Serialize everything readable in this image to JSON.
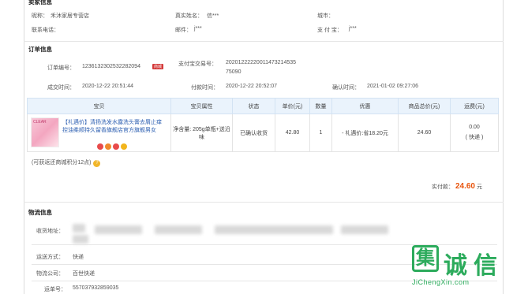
{
  "seller": {
    "section_title": "卖家信息",
    "nick_label": "昵称：",
    "nick_value": "禾沐家居专营店",
    "real_name_label": "真实姓名：",
    "real_name_value": "信***",
    "city_label": "城市：",
    "city_value": "",
    "phone_label": "联系电话：",
    "phone_value": "",
    "email_label": "邮件：",
    "email_value": "j***",
    "alipay_label": "支 付 宝：",
    "alipay_value": "j***"
  },
  "order": {
    "section_title": "订单信息",
    "order_no_label": "订单编号：",
    "order_no_value": "1236132302532282094",
    "order_no_tag": "商城",
    "alipay_trade_label": "支付宝交易号：",
    "alipay_trade_value_line1": "20201222220011473214535",
    "alipay_trade_value_line2": "75090",
    "created_label": "成交时间：",
    "created_value": "2020-12-22 20:51:44",
    "paid_label": "付款时间：",
    "paid_value": "2020-12-22 20:52:07",
    "confirm_label": "确认时间：",
    "confirm_value": "2021-01-02 09:27:06"
  },
  "table": {
    "headers": [
      "宝贝",
      "宝贝属性",
      "状态",
      "单价(元)",
      "数量",
      "优惠",
      "商品总价(元)",
      "运费(元)"
    ],
    "row": {
      "title": "【礼遇价】清扬洗发水露洗头膏去屑止痒控油柔顺持久留香旗舰店官方旗舰男女",
      "attr": "净含量: 205g单瓶+送沿味",
      "status": "已确认收货",
      "price": "42.80",
      "qty": "1",
      "discount": "- 礼遇价:省18.20元",
      "total": "24.60",
      "shipping": "0.00",
      "shipping_note": "( 快递 )"
    }
  },
  "points_note": "(可获返还商城积分12点)",
  "paid_total": {
    "label": "实付款：",
    "amount": "24.60",
    "unit": "元"
  },
  "logistics": {
    "section_title": "物流信息",
    "address_label": "收货地址：",
    "method_label": "运送方式：",
    "method_value": "快递",
    "company_label": "物流公司：",
    "company_value": "百世快递",
    "tracking_label": "运单号：",
    "tracking_value": "557037932859035"
  },
  "watermark": {
    "chars": [
      "集",
      "诚",
      "信"
    ],
    "url": "JiChengXin.com"
  }
}
